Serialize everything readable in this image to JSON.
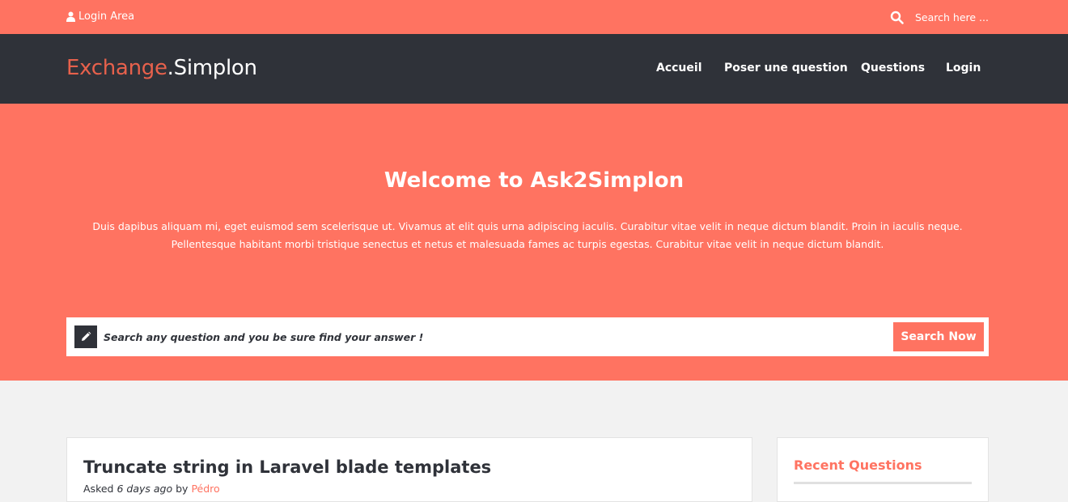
{
  "topbar": {
    "login_label": "Login Area",
    "search_placeholder": "Search here ..."
  },
  "navbar": {
    "brand_part1": "Exchange",
    "brand_part2": ".Simplon",
    "links": [
      "Accueil",
      "Poser une question",
      "Questions",
      "Login"
    ]
  },
  "hero": {
    "title": "Welcome to Ask2Simplon",
    "description": "Duis dapibus aliquam mi, eget euismod sem scelerisque ut. Vivamus at elit quis urna adipiscing iaculis. Curabitur vitae velit in neque dictum blandit. Proin in iaculis neque. Pellentesque habitant morbi tristique senectus et netus et malesuada fames ac turpis egestas. Curabitur vitae velit in neque dictum blandit.",
    "search_placeholder": "Search any question and you be sure find your answer !",
    "search_button": "Search Now"
  },
  "question": {
    "title": "Truncate string in Laravel blade templates",
    "asked_prefix": "Asked",
    "asked_time": "6 days ago",
    "by_word": "by",
    "author": "Pédro"
  },
  "sidebar": {
    "recent_title": "Recent Questions"
  },
  "colors": {
    "accent": "#ff7361",
    "dark": "#2f3239",
    "brand_accent": "#e7614c",
    "background": "#f2f2f2"
  },
  "icons": {
    "login": "user-icon",
    "search": "search-icon",
    "pencil": "pencil-icon"
  }
}
